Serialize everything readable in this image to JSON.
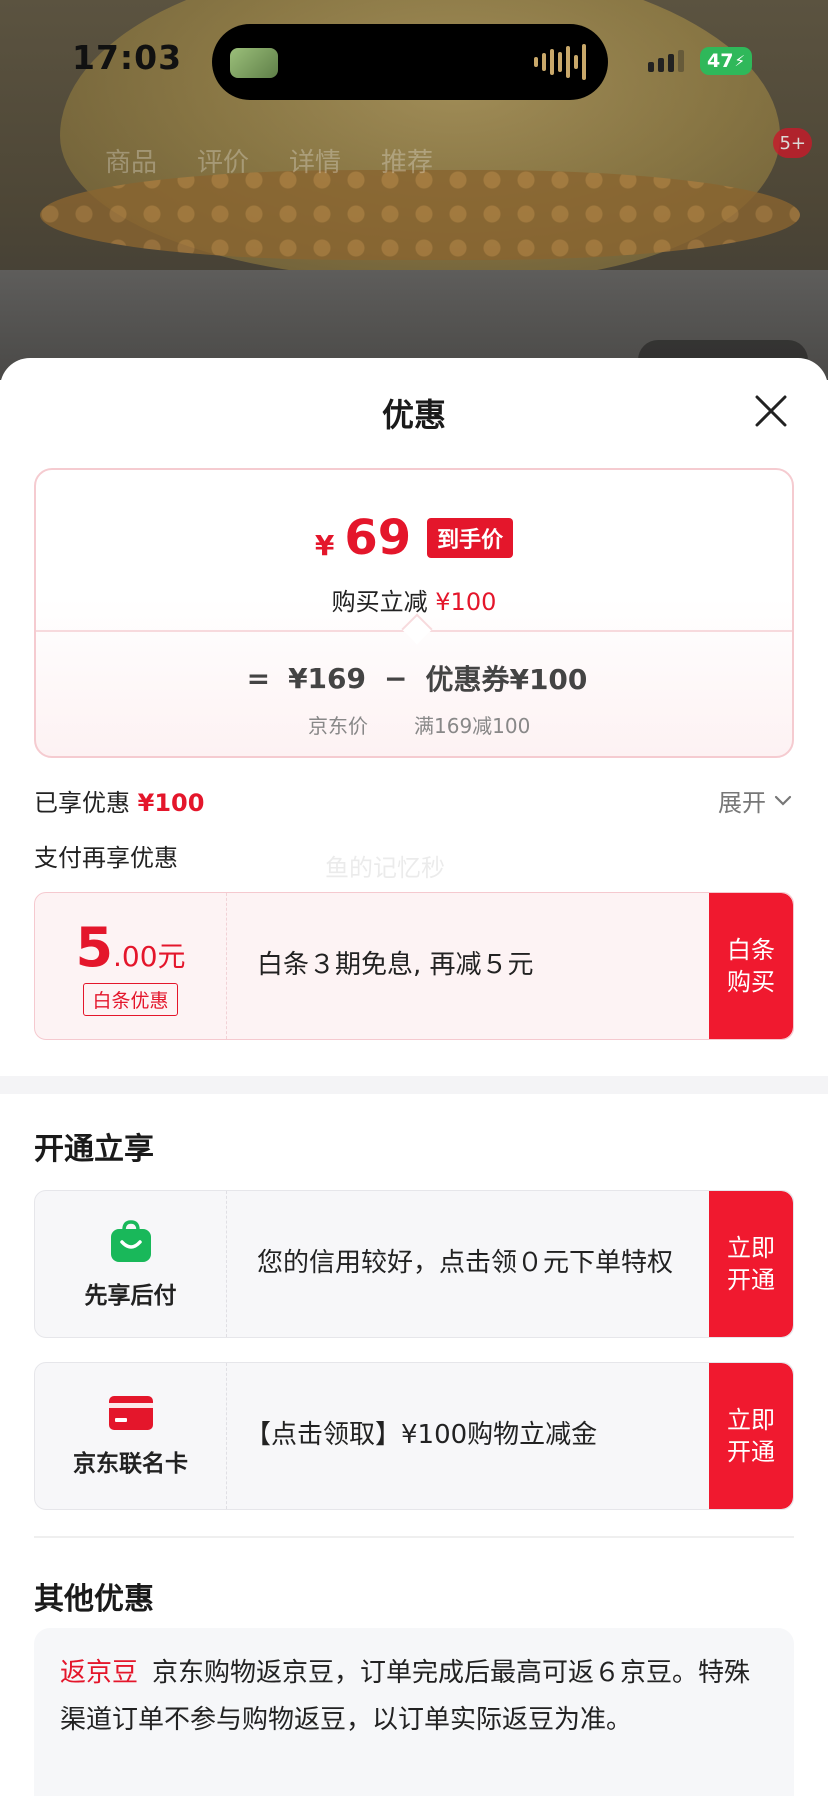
{
  "status_bar": {
    "time": "17:03",
    "battery": "47"
  },
  "background_nav": {
    "tabs": [
      "商品",
      "评价",
      "详情",
      "推荐"
    ],
    "cart_badge": "5+"
  },
  "sheet": {
    "title": "优惠"
  },
  "price_card": {
    "currency": "¥",
    "final_price": "69",
    "final_tag": "到手价",
    "reduce_label": "购买立减",
    "reduce_amount": "¥100",
    "formula": {
      "equals": "=",
      "jd_price": "¥169",
      "minus": "−",
      "coupon": "优惠券¥100",
      "jd_price_label": "京东价",
      "coupon_label": "满169减100"
    }
  },
  "enjoyed": {
    "label": "已享优惠",
    "amount": "¥100",
    "expand": "展开"
  },
  "pay_more": {
    "title": "支付再享优惠"
  },
  "watermark": "鱼的记忆秒",
  "baitiao": {
    "amount_int": "5",
    "amount_dec": ".00元",
    "tag": "白条优惠",
    "desc": "白条３期免息, 再减５元",
    "button": "白条\n购买"
  },
  "open_section": {
    "title": "开通立享"
  },
  "pay_later": {
    "label": "先享后付",
    "desc": "您的信用较好，点击领０元下单特权",
    "button": "立即\n开通"
  },
  "co_card": {
    "label": "京东联名卡",
    "desc": "【点击领取】¥100购物立减金",
    "button": "立即\n开通"
  },
  "other_section": {
    "title": "其他优惠",
    "tag": "返京豆",
    "desc": "京东购物返京豆，订单完成后最高可返６京豆。特殊渠道订单不参与购物返豆，以订单实际返豆为准。"
  },
  "colors": {
    "accent": "#e4162b",
    "button": "#f0192f",
    "green_icon": "#19b85a"
  }
}
